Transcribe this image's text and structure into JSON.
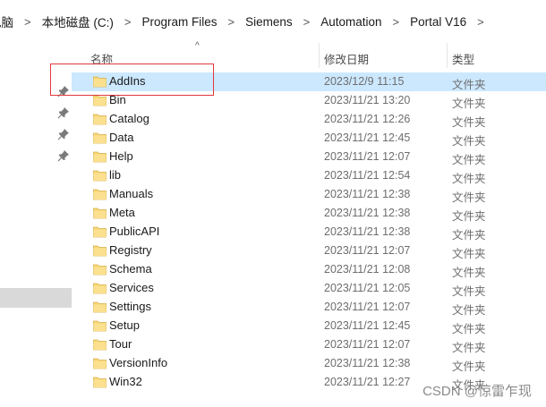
{
  "breadcrumb": [
    "电脑",
    "本地磁盘 (C:)",
    "Program Files",
    "Siemens",
    "Automation",
    "Portal V16"
  ],
  "columns": {
    "name": "名称",
    "modified": "修改日期",
    "type": "类型"
  },
  "files": [
    {
      "name": "AddIns",
      "modified": "2023/12/9 11:15",
      "type": "文件夹",
      "selected": true
    },
    {
      "name": "Bin",
      "modified": "2023/11/21 13:20",
      "type": "文件夹"
    },
    {
      "name": "Catalog",
      "modified": "2023/11/21 12:26",
      "type": "文件夹"
    },
    {
      "name": "Data",
      "modified": "2023/11/21 12:45",
      "type": "文件夹"
    },
    {
      "name": "Help",
      "modified": "2023/11/21 12:07",
      "type": "文件夹"
    },
    {
      "name": "lib",
      "modified": "2023/11/21 12:54",
      "type": "文件夹"
    },
    {
      "name": "Manuals",
      "modified": "2023/11/21 12:38",
      "type": "文件夹"
    },
    {
      "name": "Meta",
      "modified": "2023/11/21 12:38",
      "type": "文件夹"
    },
    {
      "name": "PublicAPI",
      "modified": "2023/11/21 12:38",
      "type": "文件夹"
    },
    {
      "name": "Registry",
      "modified": "2023/11/21 12:07",
      "type": "文件夹"
    },
    {
      "name": "Schema",
      "modified": "2023/11/21 12:08",
      "type": "文件夹"
    },
    {
      "name": "Services",
      "modified": "2023/11/21 12:05",
      "type": "文件夹"
    },
    {
      "name": "Settings",
      "modified": "2023/11/21 12:07",
      "type": "文件夹"
    },
    {
      "name": "Setup",
      "modified": "2023/11/21 12:45",
      "type": "文件夹"
    },
    {
      "name": "Tour",
      "modified": "2023/11/21 12:07",
      "type": "文件夹"
    },
    {
      "name": "VersionInfo",
      "modified": "2023/11/21 12:38",
      "type": "文件夹"
    },
    {
      "name": "Win32",
      "modified": "2023/11/21 12:27",
      "type": "文件夹"
    }
  ],
  "watermark": "CSDN @惊雷乍现",
  "colors": {
    "selection": "#cce8ff",
    "folder": "#f8d775",
    "annotation": "#e0393e"
  }
}
